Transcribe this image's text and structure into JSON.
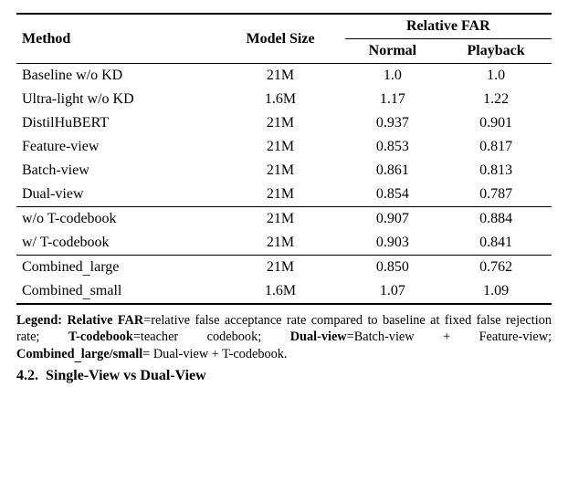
{
  "chart_data": {
    "type": "table",
    "title": null,
    "columns": [
      "Method",
      "Model Size",
      "Normal",
      "Playback"
    ],
    "column_group": "Relative FAR",
    "groups": [
      [
        {
          "method": "Baseline w/o KD",
          "size": "21M",
          "normal": "1.0",
          "playback": "1.0"
        },
        {
          "method": "Ultra-light w/o KD",
          "size": "1.6M",
          "normal": "1.17",
          "playback": "1.22"
        },
        {
          "method": "DistilHuBERT",
          "size": "21M",
          "normal": "0.937",
          "playback": "0.901"
        },
        {
          "method": "Feature-view",
          "size": "21M",
          "normal": "0.853",
          "playback": "0.817"
        },
        {
          "method": "Batch-view",
          "size": "21M",
          "normal": "0.861",
          "playback": "0.813"
        },
        {
          "method": "Dual-view",
          "size": "21M",
          "normal": "0.854",
          "playback": "0.787"
        }
      ],
      [
        {
          "method": "w/o T-codebook",
          "size": "21M",
          "normal": "0.907",
          "playback": "0.884"
        },
        {
          "method": "w/ T-codebook",
          "size": "21M",
          "normal": "0.903",
          "playback": "0.841"
        }
      ],
      [
        {
          "method": "Combined_large",
          "size": "21M",
          "normal": "0.850",
          "playback": "0.762"
        },
        {
          "method": "Combined_small",
          "size": "1.6M",
          "normal": "1.07",
          "playback": "1.09"
        }
      ]
    ]
  },
  "header": {
    "method": "Method",
    "size": "Model Size",
    "group": "Relative FAR",
    "normal": "Normal",
    "playback": "Playback"
  },
  "legend": {
    "label": "Legend:",
    "relfar_k": "Relative FAR",
    "relfar_v": "=relative false acceptance rate compared to baseline at fixed false rejection rate;",
    "tcode_k": "T-codebook",
    "tcode_v": "=teacher codebook;",
    "dual_k": "Dual-view",
    "dual_v": "=Batch-view + Feature-view;",
    "comb_k1": "Combined",
    "comb_us": "_",
    "comb_k2": "large/small",
    "comb_v": "= Dual-view + T-codebook."
  },
  "section": {
    "num": "4.2.",
    "title": "Single-View vs Dual-View"
  }
}
